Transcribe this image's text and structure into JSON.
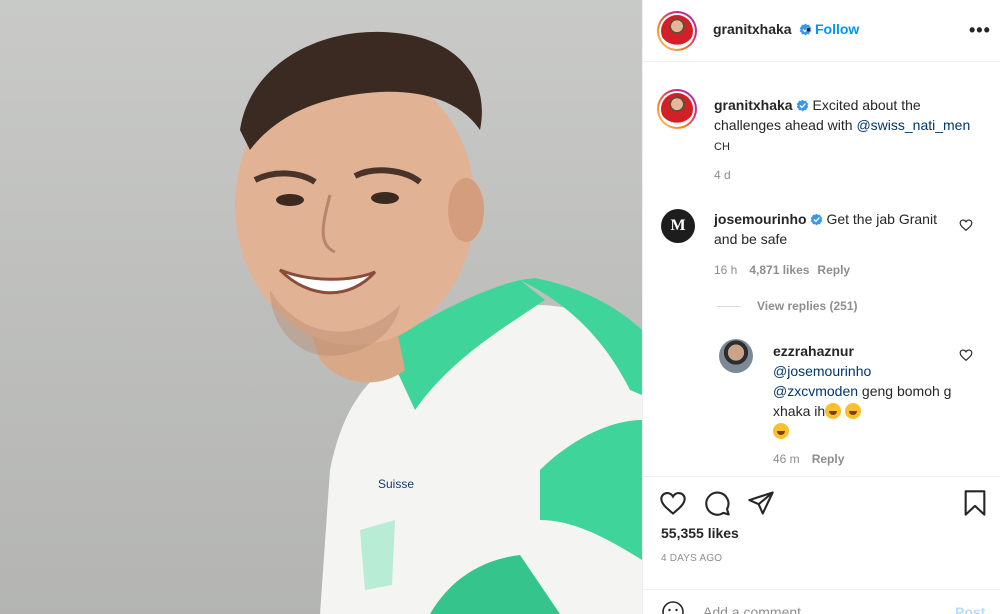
{
  "post": {
    "username": "granitxhaka",
    "follow_label": "Follow",
    "more_label": "•••",
    "caption_user": "granitxhaka",
    "caption_text": "Excited about the challenges ahead with",
    "caption_mention": "@swiss_nati_men",
    "caption_flag": "CH",
    "caption_time": "4 d"
  },
  "comments": [
    {
      "username": "josemourinho",
      "text": "Get the jab Granit and be safe",
      "time": "16 h",
      "likes": "4,871 likes",
      "reply_label": "Reply",
      "view_replies": "View replies (251)",
      "avatar_letter": "M"
    },
    {
      "username": "ezzrahaznur",
      "mention1": "@josemourinho",
      "mention2": "@zxcvmoden",
      "text": "geng bomoh g xhaka ih",
      "time": "46 m",
      "reply_label": "Reply"
    }
  ],
  "footer": {
    "likes": "55,355 likes",
    "date": "4 DAYS AGO",
    "comment_placeholder": "Add a comment…",
    "post_label": "Post"
  },
  "icons": {
    "like": "heart-icon",
    "comment": "comment-icon",
    "share": "share-icon",
    "save": "bookmark-icon",
    "emoji": "smile-icon"
  },
  "colors": {
    "link": "#0095f6",
    "mention": "#00376b",
    "verified": "#3897f0",
    "muted": "#8e8e8e",
    "jersey_green": "#3ed49a"
  }
}
